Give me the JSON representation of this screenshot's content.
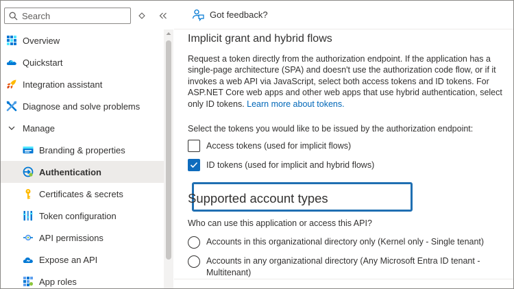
{
  "sidebar": {
    "search_placeholder": "Search",
    "items": [
      {
        "label": "Overview",
        "icon": "grid-icon",
        "sub": false,
        "active": false
      },
      {
        "label": "Quickstart",
        "icon": "cloud-icon",
        "sub": false,
        "active": false
      },
      {
        "label": "Integration assistant",
        "icon": "rocket-icon",
        "sub": false,
        "active": false
      },
      {
        "label": "Diagnose and solve problems",
        "icon": "wrench-icon",
        "sub": false,
        "active": false
      },
      {
        "label": "Manage",
        "icon": "chevron-down-icon",
        "sub": false,
        "active": false
      },
      {
        "label": "Branding & properties",
        "icon": "branding-icon",
        "sub": true,
        "active": false
      },
      {
        "label": "Authentication",
        "icon": "authentication-icon",
        "sub": true,
        "active": true
      },
      {
        "label": "Certificates & secrets",
        "icon": "key-icon",
        "sub": true,
        "active": false
      },
      {
        "label": "Token configuration",
        "icon": "token-icon",
        "sub": true,
        "active": false
      },
      {
        "label": "API permissions",
        "icon": "api-permissions-icon",
        "sub": true,
        "active": false
      },
      {
        "label": "Expose an API",
        "icon": "cloud-api-icon",
        "sub": true,
        "active": false
      },
      {
        "label": "App roles",
        "icon": "app-roles-icon",
        "sub": true,
        "active": false
      }
    ]
  },
  "topbar": {
    "feedback_label": "Got feedback?"
  },
  "implicit": {
    "heading": "Implicit grant and hybrid flows",
    "description_lines": [
      "Request a token directly from the authorization endpoint. If the application has a",
      "single-page architecture (SPA) and doesn't use the authorization code flow, or if it",
      "invokes a web API via JavaScript, select both access tokens and ID tokens. For",
      "ASP.NET Core web apps and other web apps that use hybrid authentication, select",
      "only ID tokens. "
    ],
    "learn_more": "Learn more about tokens.",
    "select_label": "Select the tokens you would like to be issued by the authorization endpoint:",
    "access_tokens_label": "Access tokens (used for implicit flows)",
    "access_tokens_checked": false,
    "id_tokens_label": "ID tokens (used for implicit and hybrid flows)",
    "id_tokens_checked": true
  },
  "account_types": {
    "heading": "Supported account types",
    "question": "Who can use this application or access this API?",
    "option1": "Accounts in this organizational directory only (Kernel only - Single tenant)",
    "option2_line1": "Accounts in any organizational directory (Any Microsoft Entra ID tenant -",
    "option2_line2": "Multitenant)"
  },
  "colors": {
    "accent": "#0f6cbd",
    "highlight_border": "#1f6fb2",
    "link": "#0067b8"
  }
}
